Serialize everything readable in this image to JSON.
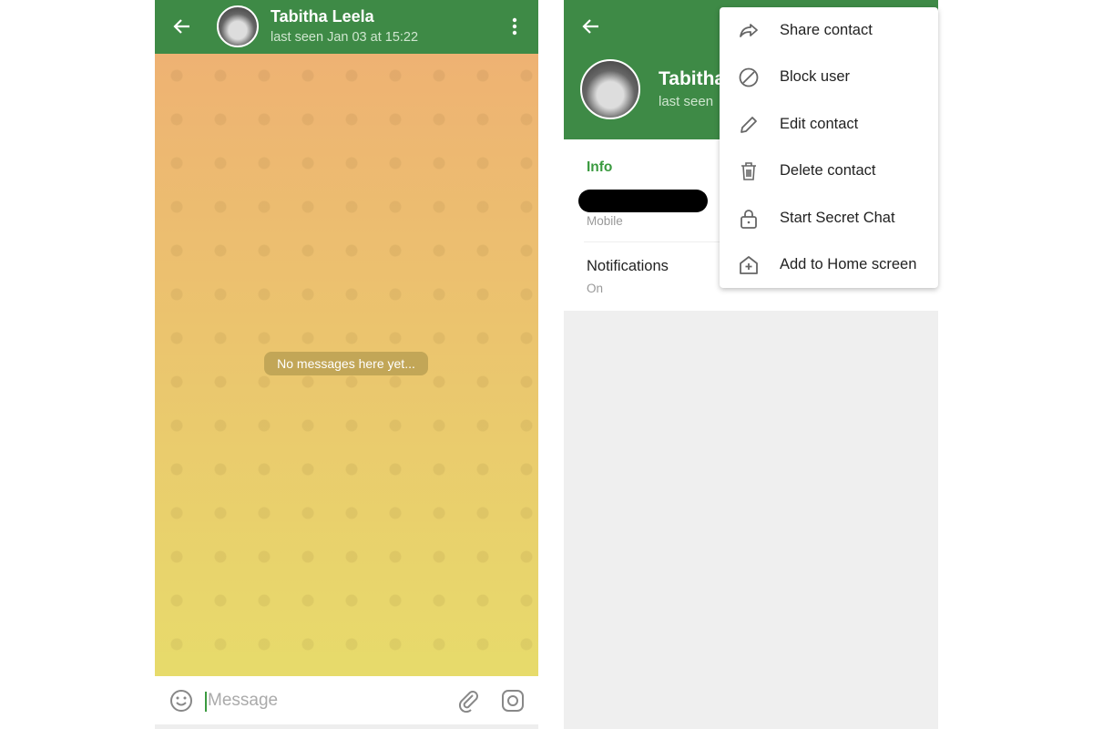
{
  "chat": {
    "contact_name": "Tabitha Leela",
    "status": "last seen Jan 03 at 15:22",
    "empty_text": "No messages here yet...",
    "input_placeholder": "Message",
    "icons": [
      "back-arrow-icon",
      "more-vert-icon",
      "emoji-icon",
      "attach-icon",
      "camera-icon"
    ]
  },
  "profile": {
    "name_visible": "Tabitha",
    "status_visible": "last seen",
    "info_heading": "Info",
    "phone_label": "Mobile",
    "notifications_label": "Notifications",
    "notifications_value": "On"
  },
  "menu": {
    "items": [
      {
        "label": "Share contact",
        "icon": "share-icon"
      },
      {
        "label": "Block user",
        "icon": "block-icon"
      },
      {
        "label": "Edit contact",
        "icon": "pencil-icon"
      },
      {
        "label": "Delete contact",
        "icon": "trash-icon"
      },
      {
        "label": "Start Secret Chat",
        "icon": "lock-icon"
      },
      {
        "label": "Add to Home screen",
        "icon": "add-home-icon"
      }
    ]
  },
  "colors": {
    "header": "#3e8a46",
    "accent": "#3a9a3f"
  }
}
